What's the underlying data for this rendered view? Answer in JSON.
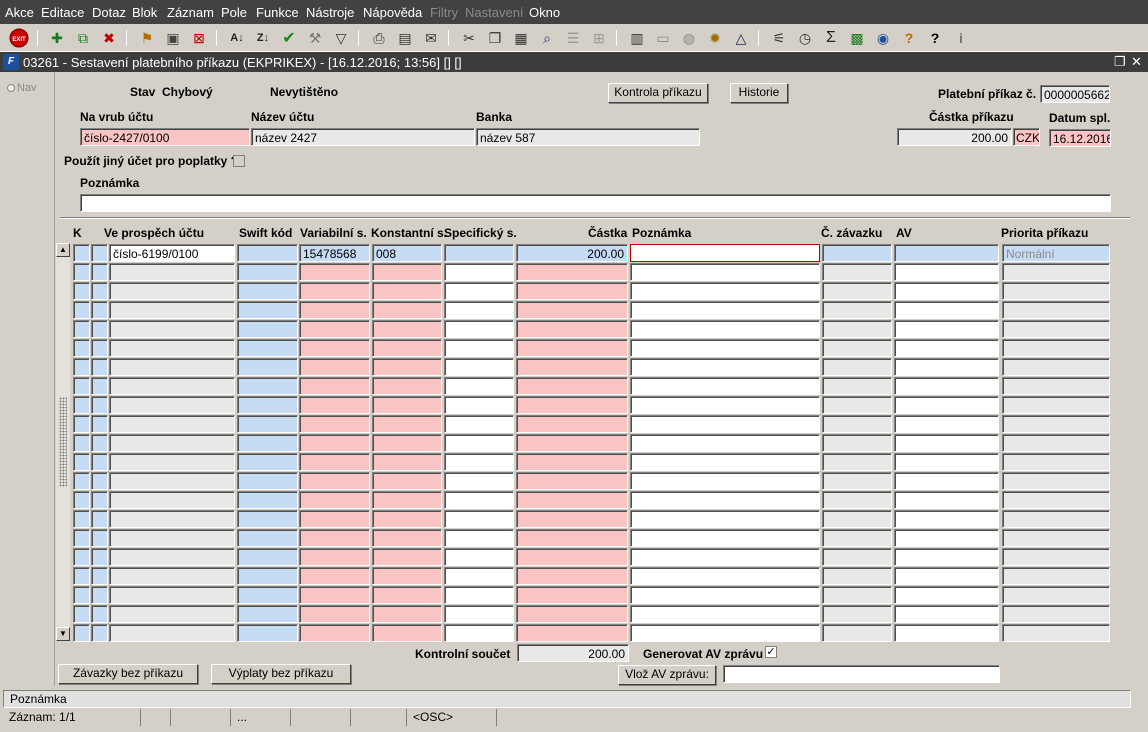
{
  "menu": {
    "items": [
      {
        "label": "Akce",
        "disabled": false
      },
      {
        "label": "Editace",
        "disabled": false
      },
      {
        "label": "Dotaz",
        "disabled": false
      },
      {
        "label": "Blok",
        "disabled": false
      },
      {
        "label": "Záznam",
        "disabled": false
      },
      {
        "label": "Pole",
        "disabled": false
      },
      {
        "label": "Funkce",
        "disabled": false
      },
      {
        "label": "Nástroje",
        "disabled": false
      },
      {
        "label": "Nápověda",
        "disabled": false
      },
      {
        "label": "Filtry",
        "disabled": true
      },
      {
        "label": "Nastavení",
        "disabled": true
      },
      {
        "label": "Okno",
        "disabled": false
      }
    ]
  },
  "toolbar": {
    "exit_label": "EXIT"
  },
  "window": {
    "title": "03261 - Sestavení platebního příkazu (EKPRIKEX) - [16.12.2016; 13:56] [] []",
    "logo": "F"
  },
  "nav": {
    "label": "Nav"
  },
  "header": {
    "stav_label": "Stav",
    "stav_value": "Chybový",
    "print_status": "Nevytištěno",
    "kontrola_button": "Kontrola příkazu",
    "historie_button": "Historie",
    "prikaz_label": "Platební příkaz č.",
    "prikaz_value": "0000005662",
    "na_vrub_label": "Na vrub účtu",
    "na_vrub_value": "číslo-2427/0100",
    "nazev_label": "Název účtu",
    "nazev_value": "název 2427",
    "banka_label": "Banka",
    "banka_value": "název 587",
    "castka_label": "Částka příkazu",
    "castka_value": "200.00",
    "mena_value": "CZK",
    "datum_label": "Datum spl.",
    "datum_value": "16.12.2016",
    "poplatky_label": "Použít jiný účet pro poplatky ?",
    "poznamka_label": "Poznámka",
    "poznamka_value": ""
  },
  "grid": {
    "columns": [
      "K",
      "Ve prospěch účtu",
      "Swift kód",
      "Variabilní s.",
      "Konstantní s.",
      "Specifický s.",
      "Částka",
      "Poznámka",
      "Č. závazku",
      "AV",
      "Priorita příkazu"
    ],
    "rows": [
      {
        "ucet": "číslo-6199/0100",
        "swift": "",
        "vs": "15478568",
        "ks": "008",
        "ss": "",
        "castka": "200.00",
        "poznamka": "",
        "zavazek": "",
        "av": "",
        "priorita": "Normální"
      }
    ],
    "empty_rows": 20
  },
  "footer": {
    "kontrolni_label": "Kontrolní součet",
    "kontrolni_value": "200.00",
    "generovat_label": "Generovat AV zprávu",
    "generovat_checked": "✓",
    "zavazky_button": "Závazky bez příkazu",
    "vyplaty_button": "Výplaty bez příkazu",
    "vloz_button": "Vlož AV zprávu:",
    "vloz_value": ""
  },
  "status": {
    "line1": "Poznámka",
    "zaznam": "Záznam: 1/1",
    "seg3": "...",
    "mode": "<OSC>"
  }
}
